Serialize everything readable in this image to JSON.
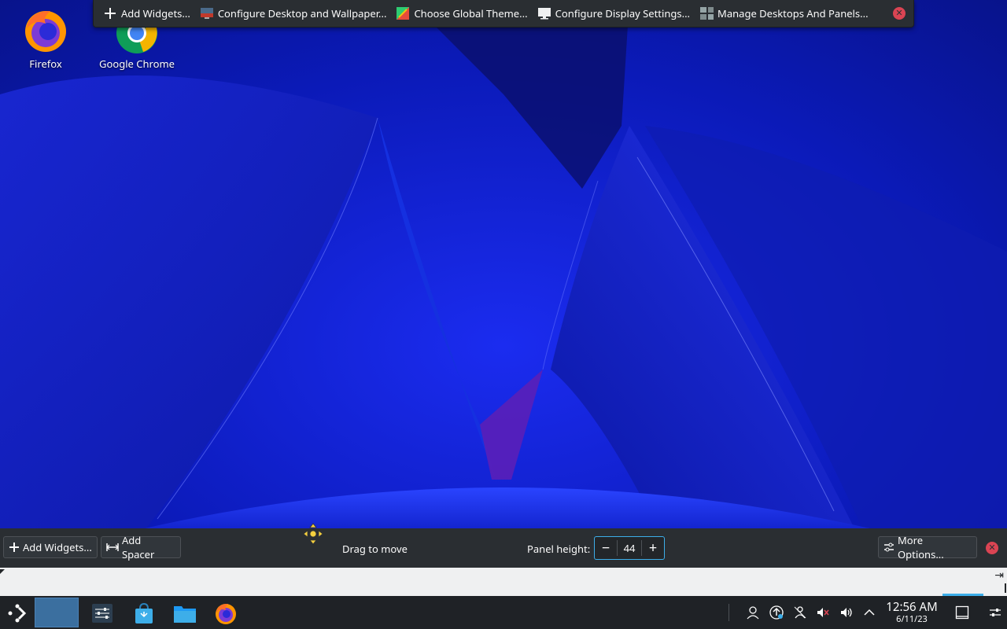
{
  "desktop": {
    "icons": [
      {
        "label": "Firefox",
        "icon": "firefox-icon"
      },
      {
        "label": "Google Chrome",
        "icon": "chrome-icon"
      }
    ]
  },
  "toolbar": {
    "items": [
      {
        "label": "Add Widgets...",
        "icon": "plus-icon"
      },
      {
        "label": "Configure Desktop and Wallpaper...",
        "icon": "desktop-config-icon"
      },
      {
        "label": "Choose Global Theme...",
        "icon": "theme-icon"
      },
      {
        "label": "Configure Display Settings...",
        "icon": "display-icon"
      },
      {
        "label": "Manage Desktops And Panels...",
        "icon": "panels-icon"
      }
    ],
    "close_icon": "close-icon"
  },
  "panel_config": {
    "add_widgets": "Add Widgets...",
    "add_spacer": "Add Spacer",
    "drag_to_move": "Drag to move",
    "panel_height_label": "Panel height:",
    "panel_height_value": "44",
    "more_options": "More Options..."
  },
  "taskbar": {
    "launcher_icon": "application-launcher-icon",
    "apps": [
      "desktop-pager-icon",
      "system-settings-icon",
      "discover-store-icon",
      "file-manager-icon",
      "firefox-icon"
    ],
    "tray": [
      "user-icon",
      "update-icon",
      "network-icon",
      "mic-muted-icon",
      "volume-icon",
      "expand-tray-icon"
    ],
    "clock_time": "12:56 AM",
    "clock_date": "6/11/23"
  },
  "colors": {
    "accent": "#3daee9",
    "close_red": "#da4453",
    "panel_bg": "#2a2e32"
  }
}
